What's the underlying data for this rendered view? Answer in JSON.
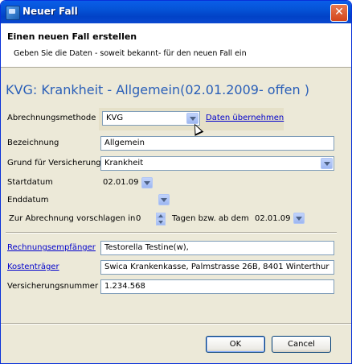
{
  "window": {
    "title": "Neuer Fall"
  },
  "header": {
    "title": "Einen neuen Fall erstellen",
    "subtitle": "Geben Sie die Daten - soweit bekannt- für den neuen Fall ein"
  },
  "case_heading": "KVG: Krankheit - Allgemein(02.01.2009- offen )",
  "form": {
    "billing_method_label": "Abrechnungsmethode",
    "billing_method_value": "KVG",
    "apply_data_link": "Daten übernehmen",
    "designation_label": "Bezeichnung",
    "designation_value": "Allgemein",
    "reason_label": "Grund für Versicherung",
    "reason_value": "Krankheit",
    "start_label": "Startdatum",
    "start_value": "02.01.09",
    "end_label": "Enddatum",
    "end_value": "",
    "suggest_label": "Zur Abrechnung vorschlagen in",
    "suggest_days": "0",
    "suggest_days_label": "Tagen bzw. ab dem",
    "suggest_date": "02.01.09",
    "recipient_label": "Rechnungsempfänger",
    "recipient_value": "Testorella Testine(w),",
    "payer_label": "Kostenträger",
    "payer_value": "Swica Krankenkasse, Palmstrasse 26B, 8401 Winterthur",
    "insurance_no_label": "Versicherungsnummer",
    "insurance_no_value": "1.234.568"
  },
  "buttons": {
    "ok": "OK",
    "cancel": "Cancel"
  },
  "colors": {
    "heading": "#2a5fb8",
    "link": "#0000cc",
    "titlebar": "#0553d6"
  }
}
